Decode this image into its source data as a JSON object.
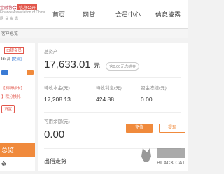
{
  "header": {
    "logo_line1": "金融协会",
    "logo_badge": "信息公开",
    "logo_line2": "Finance Association of China",
    "logo_line3": "网贷资讯",
    "nav": [
      {
        "label": "首页"
      },
      {
        "label": "网贷"
      },
      {
        "label": "会员中心"
      },
      {
        "label": "信息披露"
      }
    ]
  },
  "subbar": {
    "text": "客户总览"
  },
  "sidebar": {
    "vip_tag": "白银会员",
    "user_line": "Id: 高",
    "user_link": "[提现]",
    "refresh_link": "【刷新绑卡】",
    "bind_link": "】积分换礼",
    "setting_button": "设置",
    "active_item": "总览",
    "bottom_item": "金"
  },
  "colors": {
    "accent": "#f08a3c",
    "brand_red": "#e2574c"
  },
  "main": {
    "total_assets_label": "总资产",
    "total_assets_value": "17,633.01",
    "total_assets_unit": "元",
    "frozen_pill": "含0.00元冻结金",
    "stats": [
      {
        "label": "待收本金(元)",
        "value": "17,208.13"
      },
      {
        "label": "待收利息(元)",
        "value": "424.88"
      },
      {
        "label": "资金冻结(元)",
        "value": "0.00"
      }
    ],
    "available_label": "可用余额(元)",
    "available_value": "0.00",
    "recharge_button": "充值",
    "withdraw_button": "提现",
    "section_title": "出借走势"
  },
  "watermark": {
    "text": "BLACK CAT"
  }
}
